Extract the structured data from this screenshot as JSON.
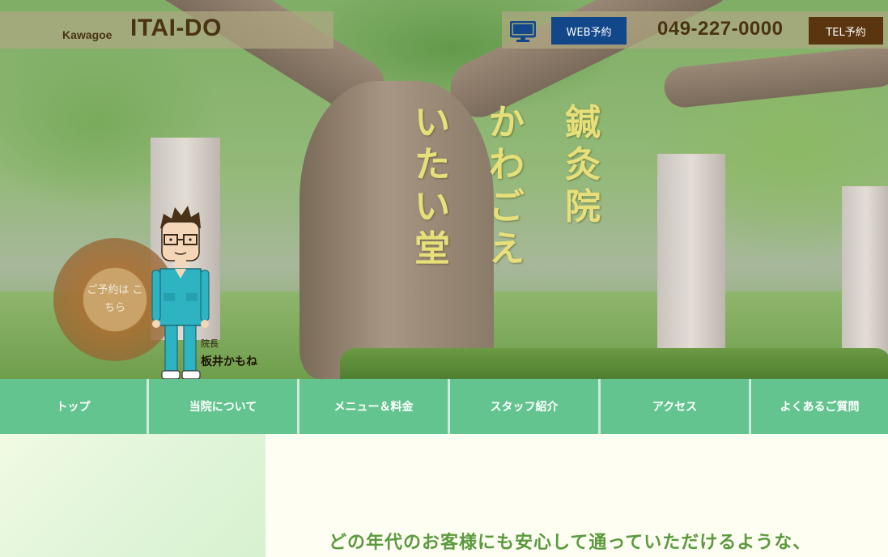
{
  "header": {
    "brand_small": "Kawagoe",
    "brand_big": "ITAI-DO",
    "web_reserve_label": "WEB予約",
    "phone": "049-227-0000",
    "tel_reserve_label": "TEL予約"
  },
  "hero": {
    "title_columns": [
      [
        "鍼",
        "灸",
        "院"
      ],
      [
        "か",
        "わ",
        "ご",
        "え"
      ],
      [
        "い",
        "た",
        "い",
        "堂"
      ]
    ],
    "reserve_text": "ご予約は こちら",
    "director_role": "院長",
    "director_name": "板井かもね"
  },
  "nav": {
    "items": [
      {
        "label": "トップ"
      },
      {
        "label": "当院について"
      },
      {
        "label": "メニュー＆料金"
      },
      {
        "label": "スタッフ紹介"
      },
      {
        "label": "アクセス"
      },
      {
        "label": "よくあるご質問"
      }
    ]
  },
  "main": {
    "tagline": "どの年代のお客様にも安心して通っていただけるような、"
  },
  "colors": {
    "nav_green": "#63c48f",
    "web_button": "#12478a",
    "tel_button": "#5a3510",
    "title_yellow": "#e7e07a",
    "tagline_green": "#5a9a3c"
  },
  "icons": [
    "monitor-icon"
  ]
}
